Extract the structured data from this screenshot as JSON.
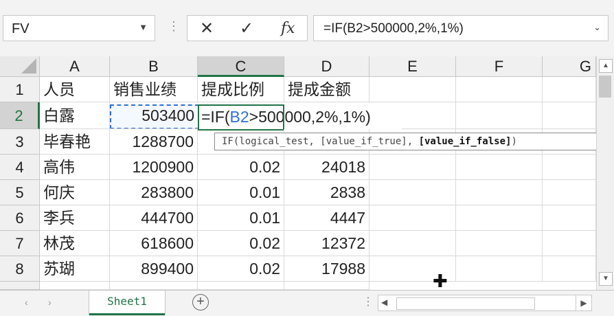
{
  "name_box": {
    "value": "FV"
  },
  "formula_bar": {
    "cancel_glyph": "✕",
    "enter_glyph": "✓",
    "fx_label": "fx",
    "formula": "=IF(B2>500000,2%,1%)"
  },
  "columns": [
    "A",
    "B",
    "C",
    "D",
    "E",
    "F",
    "G"
  ],
  "rows": [
    {
      "n": "1",
      "cells": [
        "人员",
        "销售业绩",
        "提成比例",
        "提成金额"
      ]
    },
    {
      "n": "2",
      "cells": [
        "白露",
        "503400",
        "",
        ""
      ]
    },
    {
      "n": "3",
      "cells": [
        "毕春艳",
        "1288700",
        "",
        ""
      ]
    },
    {
      "n": "4",
      "cells": [
        "高伟",
        "1200900",
        "0.02",
        "24018"
      ]
    },
    {
      "n": "5",
      "cells": [
        "何庆",
        "283800",
        "0.01",
        "2838"
      ]
    },
    {
      "n": "6",
      "cells": [
        "李兵",
        "444700",
        "0.01",
        "4447"
      ]
    },
    {
      "n": "7",
      "cells": [
        "林茂",
        "618600",
        "0.02",
        "12372"
      ]
    },
    {
      "n": "8",
      "cells": [
        "苏瑚",
        "899400",
        "0.02",
        "17988"
      ]
    }
  ],
  "edit_cell": {
    "prefix": "=IF(",
    "ref": "B2",
    "suffix": ">500000,2%,1%)"
  },
  "tooltip": {
    "prefix": "IF(logical_test, [value_if_true], ",
    "bold": "[value_if_false]",
    "suffix": ")"
  },
  "sheet_tab": {
    "label": "Sheet1"
  },
  "colors": {
    "accent": "#217346",
    "ref_blue": "#2f6fd6"
  }
}
